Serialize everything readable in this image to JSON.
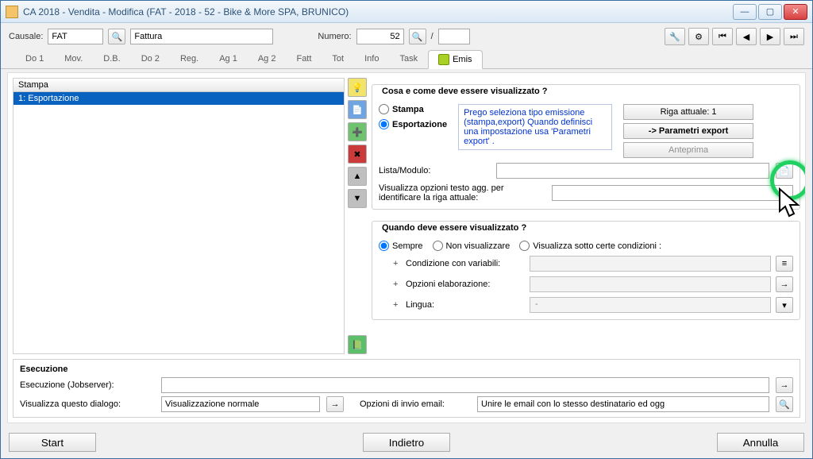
{
  "window": {
    "title": "CA 2018 - Vendita - Modifica (FAT - 2018 - 52 - Bike & More SPA, BRUNICO)"
  },
  "header": {
    "causale_label": "Causale:",
    "causale_code": "FAT",
    "causale_desc": "Fattura",
    "numero_label": "Numero:",
    "numero_value": "52",
    "numero_sep": "/"
  },
  "tabs": [
    "Do 1",
    "Mov.",
    "D.B.",
    "Do 2",
    "Reg.",
    "Ag 1",
    "Ag 2",
    "Fatt",
    "Tot",
    "Info",
    "Task",
    "Emis"
  ],
  "active_tab": 11,
  "list": {
    "header": "Stampa",
    "rows": [
      "1:  Esportazione"
    ]
  },
  "group1": {
    "title": "Cosa e come deve essere visualizzato ?",
    "opt_stampa": "Stampa",
    "opt_export": "Esportazione",
    "help": "Prego seleziona tipo emissione (stampa,export)\nQuando definisci una impostazione usa 'Parametri export' .",
    "riga_attuale_label": "Riga attuale: 1",
    "param_btn": "-> Parametri export",
    "anteprima_btn": "Anteprima",
    "lista_label": "Lista/Modulo:",
    "lista_value": "",
    "opz_label": "Visualizza opzioni testo agg. per identificare la riga attuale:",
    "opz_value": ""
  },
  "group2": {
    "title": "Quando deve essere visualizzato ?",
    "opt1": "Sempre",
    "opt2": "Non visualizzare",
    "opt3": "Visualizza sotto certe condizioni :",
    "cond_label": "Condizione con variabili:",
    "elab_label": "Opzioni elaborazione:",
    "lingua_label": "Lingua:",
    "lingua_value": "-"
  },
  "exec": {
    "title": "Esecuzione",
    "jobserver_label": "Esecuzione (Jobserver):",
    "jobserver_value": "",
    "dialog_label": "Visualizza questo dialogo:",
    "dialog_value": "Visualizzazione normale",
    "email_label": "Opzioni di invio email:",
    "email_value": "Unire le email con lo stesso destinatario ed ogg"
  },
  "footer": {
    "start": "Start",
    "indietro": "Indietro",
    "annulla": "Annulla"
  }
}
